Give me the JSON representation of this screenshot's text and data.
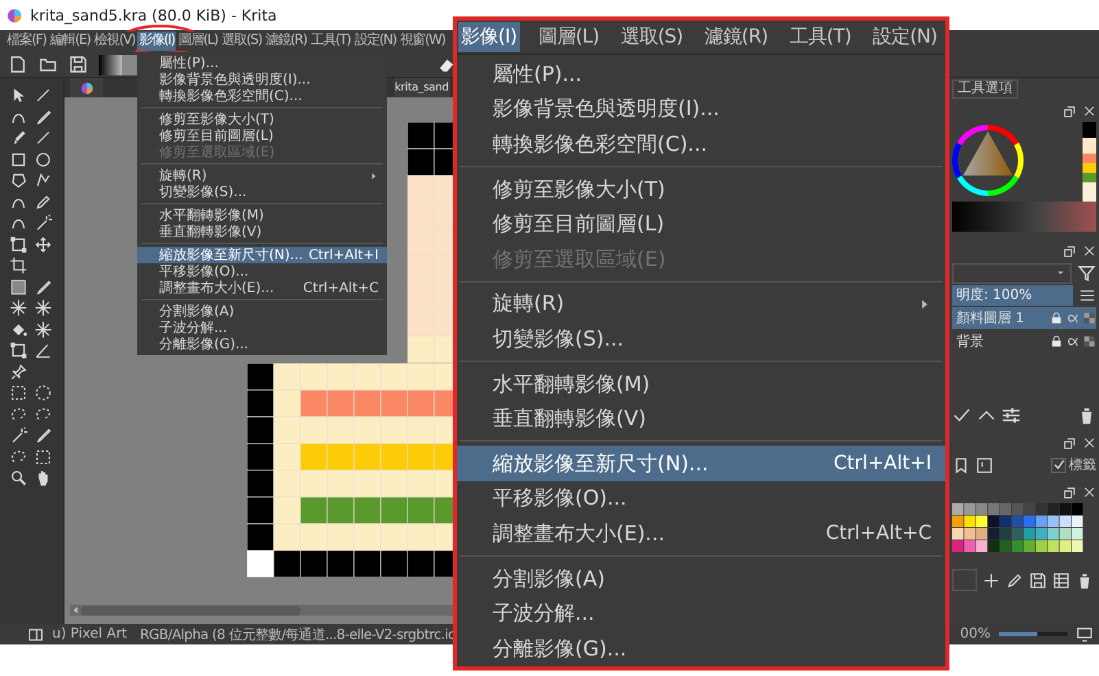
{
  "window": {
    "title": "krita_sand5.kra (80.0 KiB) - Krita"
  },
  "menubar": [
    {
      "label": "檔案(F)",
      "selected": false
    },
    {
      "label": "編輯(E)",
      "selected": false
    },
    {
      "label": "檢視(V)",
      "selected": false
    },
    {
      "label": "影像(I)",
      "selected": true
    },
    {
      "label": "圖層(L)",
      "selected": false
    },
    {
      "label": "選取(S)",
      "selected": false
    },
    {
      "label": "濾鏡(R)",
      "selected": false
    },
    {
      "label": "工具(T)",
      "selected": false
    },
    {
      "label": "設定(N)",
      "selected": false
    },
    {
      "label": "視窗(W)",
      "selected": false
    }
  ],
  "document_tab": {
    "label": "krita_sand"
  },
  "image_menu": {
    "items": [
      {
        "kind": "item",
        "label": "屬性(P)...",
        "disabled": false,
        "submenu": false,
        "selected": false
      },
      {
        "kind": "item",
        "label": "影像背景色與透明度(I)...",
        "disabled": false,
        "submenu": false,
        "selected": false
      },
      {
        "kind": "item",
        "label": "轉換影像色彩空間(C)...",
        "disabled": false,
        "submenu": false,
        "selected": false
      },
      {
        "kind": "separator"
      },
      {
        "kind": "item",
        "label": "修剪至影像大小(T)",
        "disabled": false,
        "submenu": false,
        "selected": false
      },
      {
        "kind": "item",
        "label": "修剪至目前圖層(L)",
        "disabled": false,
        "submenu": false,
        "selected": false
      },
      {
        "kind": "item",
        "label": "修剪至選取區域(E)",
        "disabled": true,
        "submenu": false,
        "selected": false
      },
      {
        "kind": "separator"
      },
      {
        "kind": "item",
        "label": "旋轉(R)",
        "disabled": false,
        "submenu": true,
        "selected": false
      },
      {
        "kind": "item",
        "label": "切變影像(S)...",
        "disabled": false,
        "submenu": false,
        "selected": false
      },
      {
        "kind": "separator"
      },
      {
        "kind": "item",
        "label": "水平翻轉影像(M)",
        "disabled": false,
        "submenu": false,
        "selected": false
      },
      {
        "kind": "item",
        "label": "垂直翻轉影像(V)",
        "disabled": false,
        "submenu": false,
        "selected": false
      },
      {
        "kind": "separator"
      },
      {
        "kind": "item",
        "label": "縮放影像至新尺寸(N)...",
        "shortcut": "Ctrl+Alt+I",
        "disabled": false,
        "submenu": false,
        "selected": true
      },
      {
        "kind": "item",
        "label": "平移影像(O)...",
        "disabled": false,
        "submenu": false,
        "selected": false
      },
      {
        "kind": "item",
        "label": "調整畫布大小(E)...",
        "shortcut": "Ctrl+Alt+C",
        "disabled": false,
        "submenu": false,
        "selected": false
      },
      {
        "kind": "separator"
      },
      {
        "kind": "item",
        "label": "分割影像(A)",
        "disabled": false,
        "submenu": false,
        "selected": false
      },
      {
        "kind": "item",
        "label": "子波分解...",
        "disabled": false,
        "submenu": false,
        "selected": false
      },
      {
        "kind": "item",
        "label": "分離影像(G)...",
        "disabled": false,
        "submenu": false,
        "selected": false
      }
    ]
  },
  "callout": {
    "menubar": [
      {
        "label": "影像(I)",
        "selected": true
      },
      {
        "label": "圖層(L)",
        "selected": false
      },
      {
        "label": "選取(S)",
        "selected": false
      },
      {
        "label": "濾鏡(R)",
        "selected": false
      },
      {
        "label": "工具(T)",
        "selected": false
      },
      {
        "label": "設定(N)",
        "selected": false
      }
    ],
    "items": [
      {
        "kind": "item",
        "label": "屬性(P)...",
        "disabled": false,
        "submenu": false,
        "selected": false
      },
      {
        "kind": "item",
        "label": "影像背景色與透明度(I)...",
        "disabled": false,
        "submenu": false,
        "selected": false
      },
      {
        "kind": "item",
        "label": "轉換影像色彩空間(C)...",
        "disabled": false,
        "submenu": false,
        "selected": false
      },
      {
        "kind": "separator"
      },
      {
        "kind": "item",
        "label": "修剪至影像大小(T)",
        "disabled": false,
        "submenu": false,
        "selected": false
      },
      {
        "kind": "item",
        "label": "修剪至目前圖層(L)",
        "disabled": false,
        "submenu": false,
        "selected": false
      },
      {
        "kind": "item",
        "label": "修剪至選取區域(E)",
        "disabled": true,
        "submenu": false,
        "selected": false
      },
      {
        "kind": "separator"
      },
      {
        "kind": "item",
        "label": "旋轉(R)",
        "disabled": false,
        "submenu": true,
        "selected": false
      },
      {
        "kind": "item",
        "label": "切變影像(S)...",
        "disabled": false,
        "submenu": false,
        "selected": false
      },
      {
        "kind": "separator"
      },
      {
        "kind": "item",
        "label": "水平翻轉影像(M)",
        "disabled": false,
        "submenu": false,
        "selected": false
      },
      {
        "kind": "item",
        "label": "垂直翻轉影像(V)",
        "disabled": false,
        "submenu": false,
        "selected": false
      },
      {
        "kind": "separator"
      },
      {
        "kind": "item",
        "label": "縮放影像至新尺寸(N)...",
        "shortcut": "Ctrl+Alt+I",
        "disabled": false,
        "submenu": false,
        "selected": true
      },
      {
        "kind": "item",
        "label": "平移影像(O)...",
        "disabled": false,
        "submenu": false,
        "selected": false
      },
      {
        "kind": "item",
        "label": "調整畫布大小(E)...",
        "shortcut": "Ctrl+Alt+C",
        "disabled": false,
        "submenu": false,
        "selected": false
      },
      {
        "kind": "separator"
      },
      {
        "kind": "item",
        "label": "分割影像(A)",
        "disabled": false,
        "submenu": false,
        "selected": false
      },
      {
        "kind": "item",
        "label": "子波分解...",
        "disabled": false,
        "submenu": false,
        "selected": false
      },
      {
        "kind": "item",
        "label": "分離影像(G)...",
        "disabled": false,
        "submenu": false,
        "selected": false
      }
    ]
  },
  "docker": {
    "tab": "工具選項",
    "opacity_field": "明度: 100%",
    "layers": [
      {
        "name": "顏料圖層 1",
        "selected": true
      },
      {
        "name": "背景",
        "selected": false
      }
    ],
    "label_option": {
      "label": "標籤",
      "checked": true
    }
  },
  "status_bar": {
    "brush": "u) Pixel Art",
    "color_info": "RGB/Alpha (8 位元整數/每通道...8-elle-V2-srgbtrc.ic",
    "zoom": "00%",
    "zoom_slider": {
      "level": 0.55
    }
  }
}
